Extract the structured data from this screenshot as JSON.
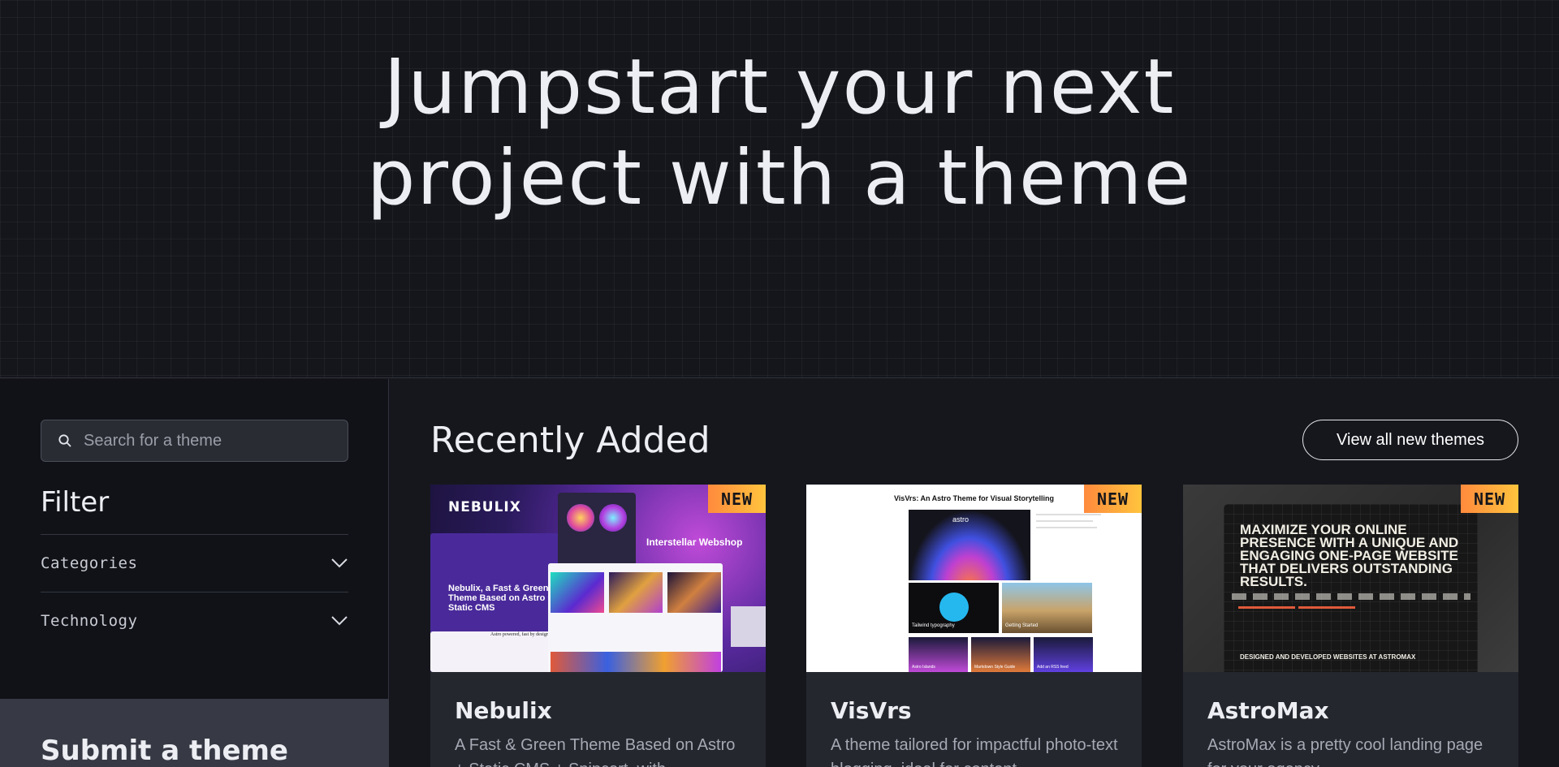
{
  "hero": {
    "title_line1": "Jumpstart your next",
    "title_line2": "project with a theme"
  },
  "sidebar": {
    "search_placeholder": "Search for a theme",
    "filter_heading": "Filter",
    "filters": [
      {
        "label": "Categories"
      },
      {
        "label": "Technology"
      }
    ],
    "submit_title": "Submit a theme"
  },
  "main": {
    "section_title": "Recently Added",
    "view_all_label": "View all new themes",
    "cards": [
      {
        "name": "Nebulix",
        "badge": "NEW",
        "description": "A Fast & Green Theme Based on Astro + Static CMS + Snipcart, with",
        "thumb": {
          "logo": "NEBULIX",
          "headline": "Nebulix, a Fast & Green Theme Based on Astro + Static CMS",
          "shop_title": "Interstellar Webshop",
          "tagline": "Astro powered, fast by design"
        }
      },
      {
        "name": "VisVrs",
        "badge": "NEW",
        "description": "A theme tailored for impactful photo-text blogging, ideal for content",
        "thumb": {
          "title": "VisVrs: An Astro Theme for Visual Storytelling",
          "logo": "astro",
          "tiles": [
            "Tailwind typography",
            "Getting Started",
            "Astro Islands",
            "Markdown Style Guide",
            "Add an RSS feed"
          ]
        }
      },
      {
        "name": "AstroMax",
        "badge": "NEW",
        "description": "AstroMax is a pretty cool landing page for your agency",
        "thumb": {
          "headline": "Maximize your online presence with a unique and engaging one-page website that delivers outstanding results.",
          "footer": "DESIGNED AND DEVELOPED WEBSITES AT ASTROMAX"
        }
      }
    ]
  },
  "colors": {
    "background": "#16171d",
    "badge_start": "#ff8a3d",
    "badge_end": "#ffc43d",
    "card": "#25272f"
  }
}
